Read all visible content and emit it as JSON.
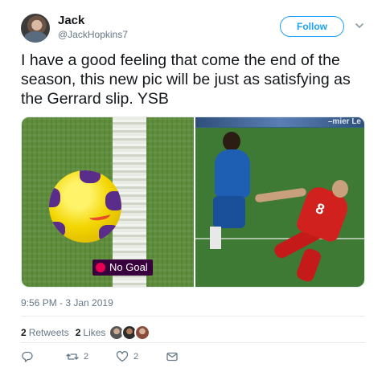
{
  "user": {
    "name": "Jack",
    "handle": "@JackHopkins7"
  },
  "follow_label": "Follow",
  "tweet": {
    "text": "I have a good feeling that come the end of the season, this new pic will be just as satisfying as the Gerrard slip. YSB"
  },
  "media": {
    "badge_text": "No Goal",
    "board_text": "–mier Le"
  },
  "timestamp": "9:56 PM - 3 Jan 2019",
  "stats": {
    "retweets_count": "2",
    "retweets_label": "Retweets",
    "likes_count": "2",
    "likes_label": "Likes"
  },
  "actions": {
    "reply_count": "",
    "retweet_count": "2",
    "like_count": "2"
  },
  "colors": {
    "accent": "#1da1f2",
    "text": "#14171a",
    "muted": "#657786",
    "nogoal_bg": "#38003c"
  },
  "icons": [
    "chevron-down-icon",
    "reply-icon",
    "retweet-icon",
    "heart-icon",
    "message-icon",
    "premier-league-icon"
  ]
}
